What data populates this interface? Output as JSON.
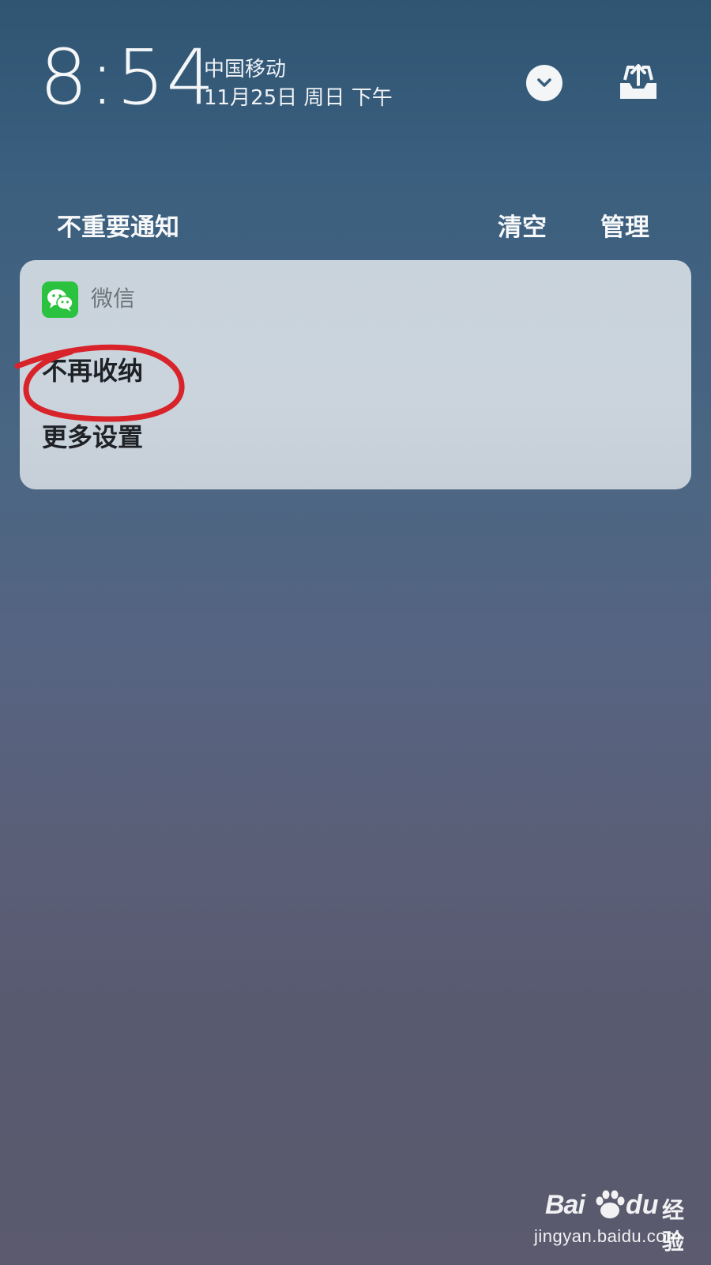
{
  "status": {
    "time": "8:54",
    "carrier": "中国移动",
    "date": "11月25日 周日 下午",
    "collapse_icon": "chevron-down-icon",
    "share_icon": "tray-upload-icon"
  },
  "section": {
    "title": "不重要通知",
    "clear_label": "清空",
    "manage_label": "管理"
  },
  "notification": {
    "app_name": "微信",
    "app_icon": "wechat-icon",
    "app_icon_color": "#2bc23f",
    "options": [
      {
        "label": "不再收纳",
        "highlighted": true
      },
      {
        "label": "更多设置",
        "highlighted": false
      }
    ]
  },
  "annotation": {
    "color": "#d8232a"
  },
  "watermark": {
    "logo_a": "Bai",
    "logo_b": "du",
    "suffix": "经验",
    "url": "jingyan.baidu.com"
  }
}
